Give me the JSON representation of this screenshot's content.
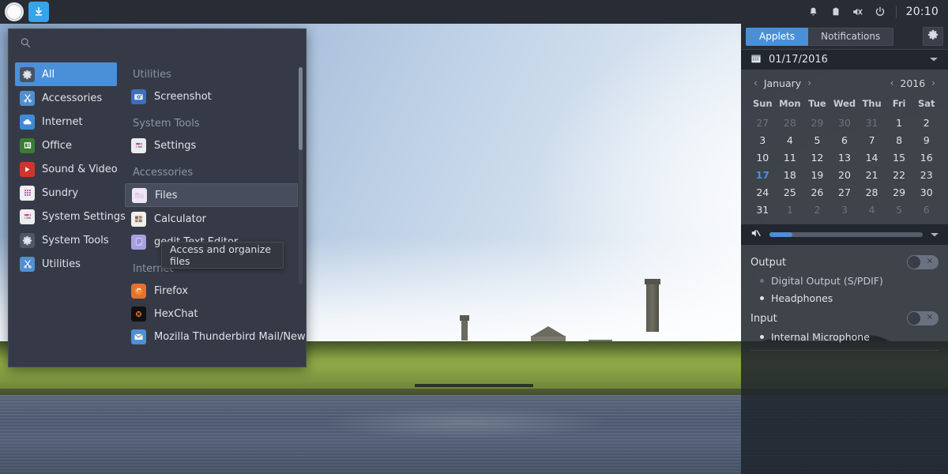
{
  "top_panel": {
    "menu_button_icon": "circle-menu-icon",
    "download_button_icon": "download-arrow-icon",
    "tray": [
      {
        "name": "notifications-icon",
        "glyph": "bell"
      },
      {
        "name": "clipboard-icon",
        "glyph": "clipboard"
      },
      {
        "name": "volume-muted-icon",
        "glyph": "speaker-muted"
      },
      {
        "name": "power-icon",
        "glyph": "power"
      }
    ],
    "clock": "20:10"
  },
  "app_menu": {
    "search_placeholder": "",
    "search_icon": "search-icon",
    "categories": [
      {
        "label": "All",
        "icon": "gear-icon",
        "active": true
      },
      {
        "label": "Accessories",
        "icon": "scissors-icon",
        "active": false
      },
      {
        "label": "Internet",
        "icon": "cloud-icon",
        "active": false
      },
      {
        "label": "Office",
        "icon": "document-icon",
        "active": false
      },
      {
        "label": "Sound & Video",
        "icon": "play-icon",
        "active": false
      },
      {
        "label": "Sundry",
        "icon": "grid-icon",
        "active": false
      },
      {
        "label": "System Settings",
        "icon": "sliders-icon",
        "active": false
      },
      {
        "label": "System Tools",
        "icon": "gear-icon",
        "active": false
      },
      {
        "label": "Utilities",
        "icon": "scissors-icon",
        "active": false
      }
    ],
    "sections": [
      {
        "title": "Utilities",
        "apps": [
          {
            "label": "Screenshot",
            "icon": "camera-icon",
            "hover": false
          }
        ]
      },
      {
        "title": "System Tools",
        "apps": [
          {
            "label": "Settings",
            "icon": "sliders-icon",
            "hover": false
          }
        ]
      },
      {
        "title": "Accessories",
        "apps": [
          {
            "label": "Files",
            "icon": "folder-icon",
            "hover": true
          },
          {
            "label": "Calculator",
            "icon": "calculator-icon",
            "hover": false
          },
          {
            "label": "gedit Text Editor",
            "icon": "text-editor-icon",
            "hover": false
          }
        ]
      },
      {
        "title": "Internet",
        "apps": [
          {
            "label": "Firefox",
            "icon": "firefox-icon",
            "hover": false
          },
          {
            "label": "HexChat",
            "icon": "hexchat-icon",
            "hover": false
          },
          {
            "label": "Mozilla Thunderbird Mail/News",
            "icon": "thunderbird-icon",
            "hover": false
          }
        ]
      }
    ],
    "tooltip": "Access and organize files"
  },
  "right_panel": {
    "tabs": [
      {
        "label": "Applets",
        "active": true
      },
      {
        "label": "Notifications",
        "active": false
      }
    ],
    "settings_icon": "gear-icon",
    "calendar": {
      "date_display": "01/17/2016",
      "calendar_icon": "calendar-icon",
      "dropdown_icon": "chevron-down-icon",
      "month": "January",
      "year": "2016",
      "prev_month_icon": "chevron-left-icon",
      "next_month_icon": "chevron-right-icon",
      "prev_year_icon": "chevron-left-icon",
      "next_year_icon": "chevron-right-icon",
      "weekdays": [
        "Sun",
        "Mon",
        "Tue",
        "Wed",
        "Thu",
        "Fri",
        "Sat"
      ],
      "weeks": [
        [
          {
            "d": "27",
            "o": true
          },
          {
            "d": "28",
            "o": true
          },
          {
            "d": "29",
            "o": true
          },
          {
            "d": "30",
            "o": true
          },
          {
            "d": "31",
            "o": true
          },
          {
            "d": "1",
            "o": false
          },
          {
            "d": "2",
            "o": false
          }
        ],
        [
          {
            "d": "3",
            "o": false
          },
          {
            "d": "4",
            "o": false
          },
          {
            "d": "5",
            "o": false
          },
          {
            "d": "6",
            "o": false
          },
          {
            "d": "7",
            "o": false
          },
          {
            "d": "8",
            "o": false
          },
          {
            "d": "9",
            "o": false
          }
        ],
        [
          {
            "d": "10",
            "o": false
          },
          {
            "d": "11",
            "o": false
          },
          {
            "d": "12",
            "o": false
          },
          {
            "d": "13",
            "o": false
          },
          {
            "d": "14",
            "o": false
          },
          {
            "d": "15",
            "o": false
          },
          {
            "d": "16",
            "o": false
          }
        ],
        [
          {
            "d": "17",
            "o": false,
            "today": true
          },
          {
            "d": "18",
            "o": false
          },
          {
            "d": "19",
            "o": false
          },
          {
            "d": "20",
            "o": false
          },
          {
            "d": "21",
            "o": false
          },
          {
            "d": "22",
            "o": false
          },
          {
            "d": "23",
            "o": false
          }
        ],
        [
          {
            "d": "24",
            "o": false
          },
          {
            "d": "25",
            "o": false
          },
          {
            "d": "26",
            "o": false
          },
          {
            "d": "27",
            "o": false
          },
          {
            "d": "28",
            "o": false
          },
          {
            "d": "29",
            "o": false
          },
          {
            "d": "30",
            "o": false
          }
        ],
        [
          {
            "d": "31",
            "o": false
          },
          {
            "d": "1",
            "o": true
          },
          {
            "d": "2",
            "o": true
          },
          {
            "d": "3",
            "o": true
          },
          {
            "d": "4",
            "o": true
          },
          {
            "d": "5",
            "o": true
          },
          {
            "d": "6",
            "o": true
          }
        ]
      ]
    },
    "audio": {
      "mute_icon": "speaker-muted-icon",
      "volume_percent": 15,
      "expand_icon": "chevron-down-icon",
      "output_label": "Output",
      "output_toggle_state": "off",
      "output_toggle_glyph": "×",
      "output_devices": [
        {
          "label": "Digital Output (S/PDIF)",
          "selected": false
        },
        {
          "label": "Headphones",
          "selected": true
        }
      ],
      "input_label": "Input",
      "input_toggle_state": "off",
      "input_toggle_glyph": "×",
      "input_devices": [
        {
          "label": "Internal Microphone",
          "selected": true
        }
      ]
    }
  },
  "colors": {
    "accent": "#4a90d9",
    "panel_bg": "#282c34",
    "menu_bg": "#353a46",
    "text": "#dfe3e9",
    "muted_text": "#8d94a1"
  }
}
